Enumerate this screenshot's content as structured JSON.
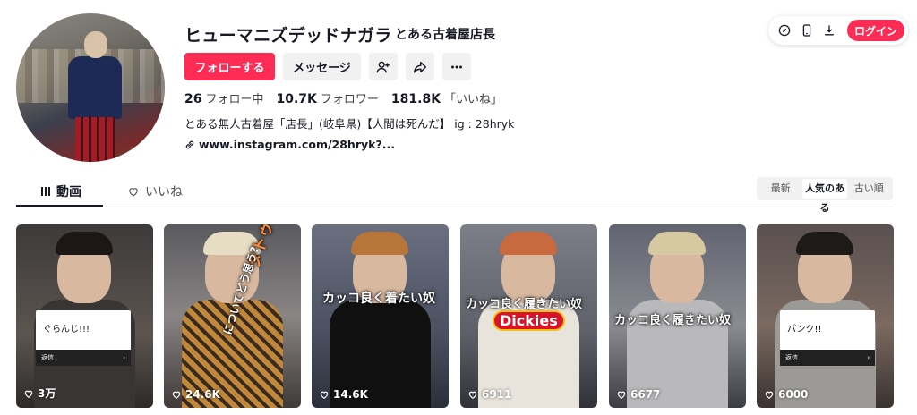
{
  "profile": {
    "name": "ヒューマニズデッドナガラ",
    "subname": "とある古着屋店長",
    "follow_label": "フォローする",
    "message_label": "メッセージ",
    "stats": [
      {
        "value": "26",
        "label": "フォロー中"
      },
      {
        "value": "10.7K",
        "label": "フォロワー"
      },
      {
        "value": "181.8K",
        "label": "「いいね」"
      }
    ],
    "bio": "とある無人古着屋「店長」(岐阜県)【人間は死んだ】 ig : 28hryk",
    "link": "www.instagram.com/28hryk?..."
  },
  "topbar": {
    "login_label": "ログイン",
    "icons": [
      "compass-icon",
      "phone-icon",
      "download-icon"
    ]
  },
  "tabs": {
    "videos_label": "動画",
    "likes_label": "いいね"
  },
  "sort": {
    "options": [
      "最新",
      "人気のある",
      "古い順"
    ],
    "selected": "人気のある"
  },
  "videos": [
    {
      "views": "3万",
      "card_text": "ぐらんじ!!!",
      "card_bar": "返信"
    },
    {
      "views": "24.6K",
      "caption_1": "タトゥーの偏見",
      "caption_2": "についてどう思う?"
    },
    {
      "views": "14.6K",
      "caption_1": "カッコ良く着たい奴"
    },
    {
      "views": "6911",
      "caption_1": "カッコ良く履きたい奴",
      "caption_2": "Dickies"
    },
    {
      "views": "6677",
      "caption_1": "カッコ良く履きたい奴"
    },
    {
      "views": "6000",
      "card_text": "パンク!!",
      "card_bar": "返信"
    }
  ],
  "colors": {
    "accent": "#fe2c55",
    "button_gray": "#f1f1f2",
    "text": "#161823"
  }
}
